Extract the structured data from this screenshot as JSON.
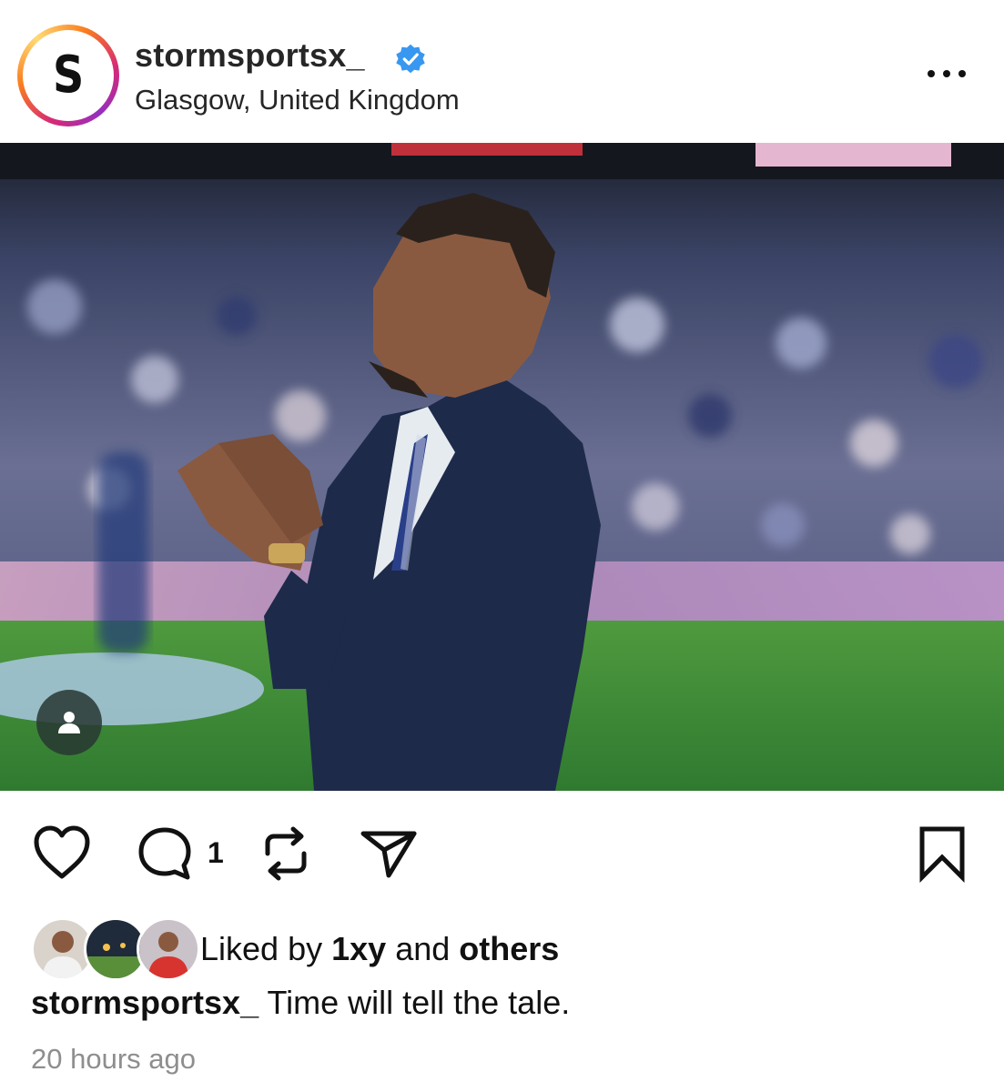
{
  "post": {
    "username": "stormsportsx_",
    "verified": true,
    "location": "Glasgow, United Kingdom",
    "avatar_letter": "S",
    "more_icon": "more-horizontal-icon"
  },
  "actions": {
    "like_icon": "heart-icon",
    "comment_icon": "comment-icon",
    "comment_count": "1",
    "repost_icon": "repost-icon",
    "share_icon": "send-icon",
    "save_icon": "bookmark-icon"
  },
  "likes": {
    "prefix": "Liked by",
    "user": "1xy",
    "connector": "and",
    "others": "others"
  },
  "caption": {
    "username": "stormsportsx_",
    "text": "Time will tell the tale."
  },
  "timestamp": "20 hours ago",
  "colors": {
    "verified": "#3897f0",
    "muted": "#8e8e8e",
    "pitch": "#3f8a3a",
    "suit": "#1d2a4a"
  }
}
